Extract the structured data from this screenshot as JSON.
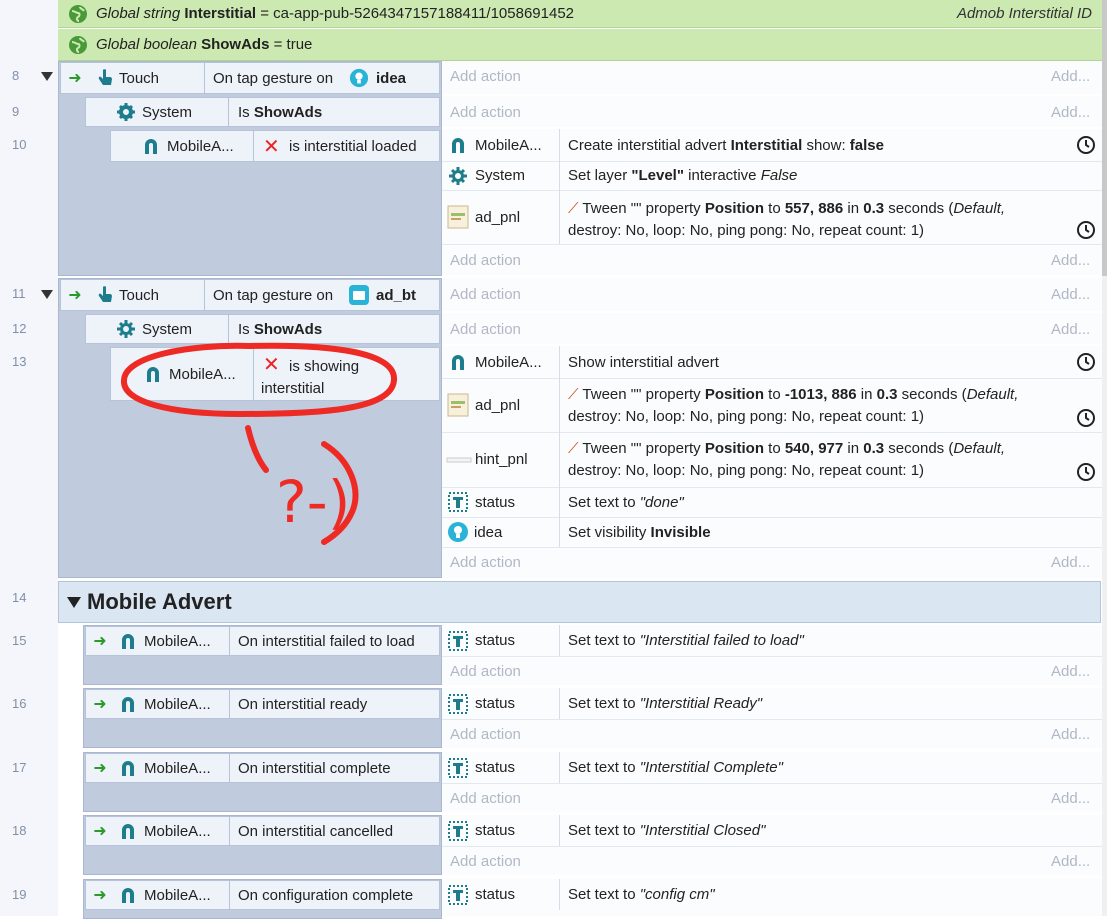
{
  "globals": [
    {
      "label_a": "Global string",
      "name": "Interstitial",
      "value": "= ca-app-pub-5264347157188411/1058691452",
      "comment": "Admob Interstitial ID"
    },
    {
      "label_a": "Global boolean",
      "name": "ShowAds",
      "value": "= true"
    }
  ],
  "rows": [
    "8",
    "9",
    "10",
    "11",
    "12",
    "13",
    "14",
    "15",
    "16",
    "17",
    "18",
    "19"
  ],
  "common": {
    "add_action": "Add action",
    "add_dots": "Add...",
    "touch": "Touch",
    "system": "System",
    "mobilea": "MobileA...",
    "is": "Is",
    "showads": "ShowAds"
  },
  "ev8": {
    "cond": "On tap gesture on",
    "target": "idea"
  },
  "ev10": {
    "cond": "is interstitial loaded",
    "a1_obj": "MobileA...",
    "a1_pre": "Create interstitial advert",
    "a1_b1": "Interstitial",
    "a1_mid": "show:",
    "a1_b2": "false",
    "a2_obj": "System",
    "a2_pre": "Set layer",
    "a2_b1": "\"Level\"",
    "a2_mid": "interactive",
    "a2_i1": "False",
    "a3_obj": "ad_pnl",
    "a3_l1a": "Tween \"\" property",
    "a3_l1b": "Position",
    "a3_l1c": "to",
    "a3_l1d": "557, 886",
    "a3_l1e": "in",
    "a3_l1f": "0.3",
    "a3_l1g": "seconds (",
    "a3_l1h": "Default,",
    "a3_l2": "destroy: No, loop: No, ping pong: No, repeat count: 1)"
  },
  "ev11": {
    "cond": "On tap gesture on",
    "target": "ad_bt"
  },
  "ev13": {
    "cond_l1": "is showing",
    "cond_l2": "interstitial",
    "a1_obj": "MobileA...",
    "a1_text": "Show interstitial advert",
    "a2_obj": "ad_pnl",
    "a2_l1a": "Tween \"\" property",
    "a2_l1b": "Position",
    "a2_l1c": "to",
    "a2_l1d": "-1013, 886",
    "a2_l1e": "in",
    "a2_l1f": "0.3",
    "a2_l1g": "seconds (",
    "a2_l1h": "Default,",
    "a2_l2": "destroy: No, loop: No, ping pong: No, repeat count: 1)",
    "a3_obj": "hint_pnl",
    "a3_l1a": "Tween \"\" property",
    "a3_l1b": "Position",
    "a3_l1c": "to",
    "a3_l1d": "540, 977",
    "a3_l1e": "in",
    "a3_l1f": "0.3",
    "a3_l1g": "seconds (",
    "a3_l1h": "Default,",
    "a3_l2": "destroy: No, loop: No, ping pong: No, repeat count: 1)",
    "a4_obj": "status",
    "a4_pre": "Set text to",
    "a4_i": "\"done\"",
    "a5_obj": "idea",
    "a5_pre": "Set visibility",
    "a5_b": "Invisible"
  },
  "group14": {
    "title": "Mobile Advert"
  },
  "ev15": {
    "cond": "On interstitial failed to load",
    "obj": "status",
    "pre": "Set text to",
    "val": "\"Interstitial failed to load\""
  },
  "ev16": {
    "cond": "On interstitial ready",
    "obj": "status",
    "pre": "Set text to",
    "val": "\"Interstitial Ready\""
  },
  "ev17": {
    "cond": "On interstitial complete",
    "obj": "status",
    "pre": "Set text to",
    "val": "\"Interstitial Complete\""
  },
  "ev18": {
    "cond": "On interstitial cancelled",
    "obj": "status",
    "pre": "Set text to",
    "val": "\"Interstitial Closed\""
  },
  "ev19": {
    "cond": "On configuration complete",
    "obj": "status",
    "pre": "Set text to",
    "val": "\"config cm\""
  },
  "annotation": {
    "text": "?-)"
  },
  "colors": {
    "global_bg": "#cde9b2",
    "block_bg": "#c0cbde",
    "cond_bg": "#eef2f9",
    "accent_teal": "#1e7d8c",
    "annotation_red": "#ee2a24"
  }
}
